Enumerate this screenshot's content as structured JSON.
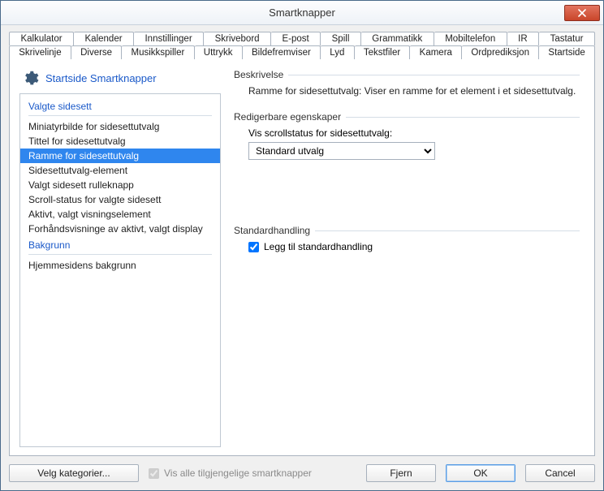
{
  "window": {
    "title": "Smartknapper"
  },
  "tabs": {
    "row1": [
      "Kalkulator",
      "Kalender",
      "Innstillinger",
      "Skrivebord",
      "E-post",
      "Spill",
      "Grammatikk",
      "Mobiltelefon",
      "IR",
      "Tastatur"
    ],
    "row2": [
      "Skrivelinje",
      "Diverse",
      "Musikkspiller",
      "Uttrykk",
      "Bildefremviser",
      "Lyd",
      "Tekstfiler",
      "Kamera",
      "Ordprediksjon",
      "Startside"
    ],
    "active": "Startside"
  },
  "panel": {
    "header": "Startside Smartknapper"
  },
  "list": {
    "group1_title": "Valgte sidesett",
    "group1_items": [
      "Miniatyrbilde for sidesettutvalg",
      "Tittel for sidesettutvalg",
      "Ramme for sidesettutvalg",
      "Sidesettutvalg-element",
      "Valgt sidesett rulleknapp",
      "Scroll-status for valgte sidesett",
      "Aktivt, valgt visningselement",
      "Forhåndsvisninge av aktivt, valgt display"
    ],
    "selected_index": 2,
    "group2_title": "Bakgrunn",
    "group2_items": [
      "Hjemmesidens bakgrunn"
    ]
  },
  "description": {
    "section_title": "Beskrivelse",
    "text": "Ramme for sidesettutvalg: Viser en ramme for et element i et sidesettutvalg."
  },
  "properties": {
    "section_title": "Redigerbare egenskaper",
    "label": "Vis scrollstatus for sidesettutvalg:",
    "value": "Standard utvalg"
  },
  "default_action": {
    "section_title": "Standardhandling",
    "checkbox_label": "Legg til standardhandling",
    "checked": true
  },
  "footer": {
    "categories_btn": "Velg kategorier...",
    "show_all_label": "Vis alle tilgjengelige smartknapper",
    "show_all_checked": true,
    "remove_btn": "Fjern",
    "ok_btn": "OK",
    "cancel_btn": "Cancel"
  }
}
